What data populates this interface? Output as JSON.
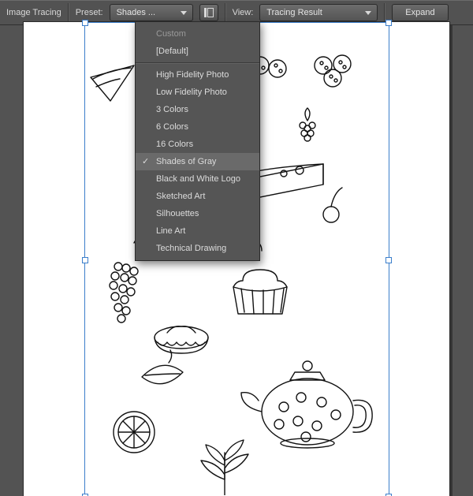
{
  "toolbar": {
    "title": "Image Tracing",
    "preset_label": "Preset:",
    "preset_value": "Shades ...",
    "panel_icon": "tracing-panel-icon",
    "view_label": "View:",
    "view_value": "Tracing Result",
    "expand_label": "Expand"
  },
  "preset_menu": {
    "items": [
      {
        "label": "Custom",
        "dim": true
      },
      {
        "label": "[Default]"
      },
      {
        "sep": true
      },
      {
        "label": "High Fidelity Photo"
      },
      {
        "label": "Low Fidelity Photo"
      },
      {
        "label": "3 Colors"
      },
      {
        "label": "6 Colors"
      },
      {
        "label": "16 Colors"
      },
      {
        "label": "Shades of Gray",
        "selected": true,
        "checked": true
      },
      {
        "label": "Black and White Logo"
      },
      {
        "label": "Sketched Art"
      },
      {
        "label": "Silhouettes"
      },
      {
        "label": "Line Art"
      },
      {
        "label": "Technical Drawing"
      }
    ]
  }
}
